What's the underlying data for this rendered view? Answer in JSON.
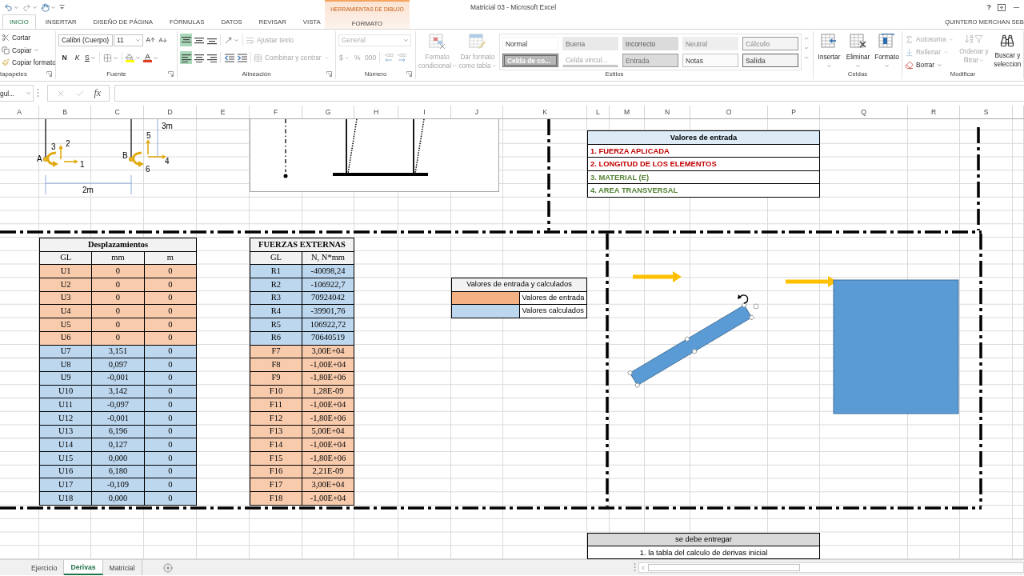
{
  "window": {
    "title": "Matricial 03 - Microsoft Excel",
    "help": "?",
    "user": "QUINTERO MERCHAN SEB"
  },
  "tabs": [
    {
      "label": "INICIO",
      "selected": true
    },
    {
      "label": "INSERTAR",
      "selected": false
    },
    {
      "label": "DISEÑO DE PÁGINA",
      "selected": false
    },
    {
      "label": "FÓRMULAS",
      "selected": false
    },
    {
      "label": "DATOS",
      "selected": false
    },
    {
      "label": "REVISAR",
      "selected": false
    },
    {
      "label": "VISTA",
      "selected": false
    }
  ],
  "contextual": {
    "group": "HERRAMIENTAS DE DIBUJO",
    "tabs": [
      {
        "label": "FORMATO",
        "selected": false
      }
    ]
  },
  "ribbon": {
    "clipboard": {
      "label": "tapapeles",
      "buttons": [
        {
          "kind": "cut",
          "label": "Cortar",
          "dropdown": false
        },
        {
          "kind": "copy",
          "label": "Copiar",
          "dropdown": true
        },
        {
          "kind": "painter",
          "label": "Copiar formato",
          "dropdown": false
        }
      ]
    },
    "font": {
      "label": "Fuente",
      "name": "Calibri (Cuerpo)",
      "size": "11",
      "styles": [
        {
          "kind": "bold",
          "label": "N",
          "dropdown": false
        },
        {
          "kind": "italic",
          "label": "K",
          "dropdown": false
        },
        {
          "kind": "underline",
          "label": "S",
          "dropdown": true
        }
      ]
    },
    "alignment": {
      "label": "Alineación",
      "vertical": [
        {
          "kind": "top",
          "selected": true
        },
        {
          "kind": "middle",
          "selected": false
        },
        {
          "kind": "bottom",
          "selected": false
        }
      ],
      "horizontal": [
        {
          "kind": "left",
          "selected": true
        },
        {
          "kind": "center",
          "selected": false
        },
        {
          "kind": "right",
          "selected": false
        }
      ],
      "wrap": {
        "label": "Ajustar texto",
        "disabled": true
      },
      "merge": {
        "label": "Combinar y centrar",
        "disabled": true
      }
    },
    "number": {
      "label": "Número",
      "format": "General",
      "disabled": true,
      "symbols": [
        {
          "label": "$",
          "dropdown": true
        },
        {
          "label": "%",
          "dropdown": false
        },
        {
          "label": "000",
          "dropdown": false
        }
      ]
    },
    "styles": {
      "label": "Estilos",
      "buttons": [
        {
          "kind": "conditional",
          "lines": [
            "Formato",
            "condicional"
          ],
          "disabled": true
        },
        {
          "kind": "table",
          "lines": [
            "Dar formato",
            "como tabla"
          ],
          "disabled": true
        }
      ],
      "gallery": {
        "disabled": true,
        "cells": [
          {
            "kind": "normal",
            "label": "Normal"
          },
          {
            "kind": "good",
            "label": "Buena"
          },
          {
            "kind": "bad",
            "label": "Incorrecto"
          },
          {
            "kind": "neutral",
            "label": "Neutral"
          },
          {
            "kind": "calc",
            "label": "Cálculo"
          },
          {
            "kind": "check",
            "label": "Celda de co..."
          },
          {
            "kind": "linked",
            "label": "Celda vincul..."
          },
          {
            "kind": "input",
            "label": "Entrada"
          },
          {
            "kind": "note",
            "label": "Notas"
          },
          {
            "kind": "output",
            "label": "Salida"
          }
        ]
      }
    },
    "cells": {
      "label": "Celdas",
      "buttons": [
        {
          "kind": "insert",
          "label": "Insertar"
        },
        {
          "kind": "delete",
          "label": "Eliminar"
        },
        {
          "kind": "format",
          "label": "Formato"
        }
      ]
    },
    "editing": {
      "label": "Modificar",
      "small": [
        {
          "kind": "autosum",
          "label": "Autosuma",
          "disabled": true
        },
        {
          "kind": "fill",
          "label": "Rellenar",
          "disabled": true
        },
        {
          "kind": "clear",
          "label": "Borrar",
          "disabled": false
        }
      ],
      "large": [
        {
          "kind": "sort",
          "lines": [
            "Ordenar y",
            "filtrar"
          ],
          "disabled": true
        },
        {
          "kind": "find",
          "lines": [
            "Buscar y",
            "seleccion"
          ],
          "disabled": false
        }
      ]
    }
  },
  "formula_bar": {
    "name_box": "gul...",
    "function_label": "fx"
  },
  "columns": [
    "A",
    "B",
    "C",
    "D",
    "E",
    "F",
    "G",
    "H",
    "I",
    "J",
    "K",
    "L",
    "M",
    "N",
    "O",
    "P",
    "Q",
    "R",
    "S"
  ],
  "diagram": {
    "nodes": [
      {
        "label": "A",
        "dofs": [
          "1",
          "2",
          "3"
        ]
      },
      {
        "label": "B",
        "dofs": [
          "4",
          "5",
          "6"
        ]
      }
    ],
    "height": "3m",
    "span": "2m"
  },
  "inputs_table": {
    "title": "Valores de entrada",
    "items": [
      {
        "text": "1. FUERZA APLICADA",
        "color": "#c00000"
      },
      {
        "text": "2. LONGITUD DE LOS ELEMENTOS",
        "color": "#c00000"
      },
      {
        "text": "3. MATERIAL (E)",
        "color": "#548235"
      },
      {
        "text": "4. AREA TRANSVERSAL",
        "color": "#548235"
      }
    ]
  },
  "displacements": {
    "title": "Desplazamientos",
    "columns": [
      "GL",
      "mm",
      "m"
    ],
    "rows": [
      {
        "cells": [
          "U1",
          "0",
          "0"
        ],
        "color": "#f8cbad"
      },
      {
        "cells": [
          "U2",
          "0",
          "0"
        ],
        "color": "#f8cbad"
      },
      {
        "cells": [
          "U3",
          "0",
          "0"
        ],
        "color": "#f8cbad"
      },
      {
        "cells": [
          "U4",
          "0",
          "0"
        ],
        "color": "#f8cbad"
      },
      {
        "cells": [
          "U5",
          "0",
          "0"
        ],
        "color": "#f8cbad"
      },
      {
        "cells": [
          "U6",
          "0",
          "0"
        ],
        "color": "#f8cbad"
      },
      {
        "cells": [
          "U7",
          "3,151",
          "0"
        ],
        "color": "#bdd7ee"
      },
      {
        "cells": [
          "U8",
          "0,097",
          "0"
        ],
        "color": "#bdd7ee"
      },
      {
        "cells": [
          "U9",
          "-0,001",
          "0"
        ],
        "color": "#bdd7ee"
      },
      {
        "cells": [
          "U10",
          "3,142",
          "0"
        ],
        "color": "#bdd7ee"
      },
      {
        "cells": [
          "U11",
          "-0,097",
          "0"
        ],
        "color": "#bdd7ee"
      },
      {
        "cells": [
          "U12",
          "-0,001",
          "0"
        ],
        "color": "#bdd7ee"
      },
      {
        "cells": [
          "U13",
          "6,196",
          "0"
        ],
        "color": "#bdd7ee"
      },
      {
        "cells": [
          "U14",
          "0,127",
          "0"
        ],
        "color": "#bdd7ee"
      },
      {
        "cells": [
          "U15",
          "0,000",
          "0"
        ],
        "color": "#bdd7ee"
      },
      {
        "cells": [
          "U16",
          "6,180",
          "0"
        ],
        "color": "#bdd7ee"
      },
      {
        "cells": [
          "U17",
          "-0,109",
          "0"
        ],
        "color": "#bdd7ee"
      },
      {
        "cells": [
          "U18",
          "0,000",
          "0"
        ],
        "color": "#bdd7ee"
      }
    ]
  },
  "forces": {
    "title": "FUERZAS EXTERNAS",
    "columns": [
      "GL",
      "N, N*mm"
    ],
    "rows": [
      {
        "cells": [
          "R1",
          "-40098,24"
        ],
        "color": "#bdd7ee"
      },
      {
        "cells": [
          "R2",
          "-106922,7"
        ],
        "color": "#bdd7ee"
      },
      {
        "cells": [
          "R3",
          "70924042"
        ],
        "color": "#bdd7ee"
      },
      {
        "cells": [
          "R4",
          "-39901,76"
        ],
        "color": "#bdd7ee"
      },
      {
        "cells": [
          "R5",
          "106922,72"
        ],
        "color": "#bdd7ee"
      },
      {
        "cells": [
          "R6",
          "70640519"
        ],
        "color": "#bdd7ee"
      },
      {
        "cells": [
          "F7",
          "3,00E+04"
        ],
        "color": "#f8cbad"
      },
      {
        "cells": [
          "F8",
          "-1,00E+04"
        ],
        "color": "#f8cbad"
      },
      {
        "cells": [
          "F9",
          "-1,80E+06"
        ],
        "color": "#f8cbad"
      },
      {
        "cells": [
          "F10",
          "1,28E-09"
        ],
        "color": "#f8cbad"
      },
      {
        "cells": [
          "F11",
          "-1,00E+04"
        ],
        "color": "#f8cbad"
      },
      {
        "cells": [
          "F12",
          "-1,80E+06"
        ],
        "color": "#f8cbad"
      },
      {
        "cells": [
          "F13",
          "5,00E+04"
        ],
        "color": "#f8cbad"
      },
      {
        "cells": [
          "F14",
          "-1,00E+04"
        ],
        "color": "#f8cbad"
      },
      {
        "cells": [
          "F15",
          "-1,80E+06"
        ],
        "color": "#f8cbad"
      },
      {
        "cells": [
          "F16",
          "2,21E-09"
        ],
        "color": "#f8cbad"
      },
      {
        "cells": [
          "F17",
          "3,00E+04"
        ],
        "color": "#f8cbad"
      },
      {
        "cells": [
          "F18",
          "-1,00E+04"
        ],
        "color": "#f8cbad"
      }
    ]
  },
  "legend": {
    "title": "Valores de entrada y calculados",
    "items": [
      {
        "label": "Valores de entrada",
        "color": "#f4b183"
      },
      {
        "label": "Valores calculados",
        "color": "#bdd7ee"
      }
    ]
  },
  "deliverables": {
    "title": "se debe entregar",
    "items": [
      "1. la tabla del calculo de derivas inicial"
    ]
  },
  "sheets": [
    {
      "label": "Ejercicio",
      "selected": false
    },
    {
      "label": "Derivas",
      "selected": true
    },
    {
      "label": "Matricial",
      "selected": false
    }
  ]
}
